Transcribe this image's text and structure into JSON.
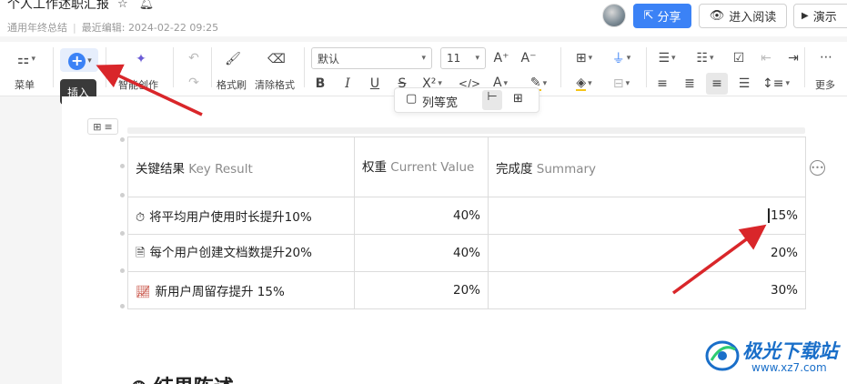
{
  "header": {
    "title": "个人工作述职汇报",
    "subtitle_tag": "通用年终总结",
    "last_edit_label": "最近编辑:",
    "last_edit_time": "2024-02-22 09:25",
    "share_label": "分享",
    "read_label": "进入阅读",
    "present_label": "演示"
  },
  "toolbar": {
    "menu_label": "菜单",
    "insert_tooltip": "插入",
    "ai_label": "智能创作",
    "format_brush_label": "格式刷",
    "clear_format_label": "清除格式",
    "font_family": "默认",
    "font_size": "11",
    "more_label": "更多"
  },
  "table_float": {
    "label": "列等宽"
  },
  "table": {
    "headers": [
      {
        "zh": "关键结果 ",
        "en": "Key Result"
      },
      {
        "zh": "权重 ",
        "en": "Current Value"
      },
      {
        "zh": "完成度 ",
        "en": "Summary"
      }
    ],
    "rows": [
      {
        "icon": "stopwatch-icon",
        "result": "将平均用户使用时长提升10%",
        "weight": "40%",
        "completion": "15%"
      },
      {
        "icon": "document-icon",
        "result": "每个用户创建文档数提升20%",
        "weight": "40%",
        "completion": "20%"
      },
      {
        "icon": "chart-icon",
        "result": "新用户周留存提升 15%",
        "weight": "20%",
        "completion": "30%"
      }
    ]
  },
  "watermark": {
    "name": "极光下载站",
    "url": "www.xz7.com"
  },
  "bottom_heading": "结果陈述"
}
